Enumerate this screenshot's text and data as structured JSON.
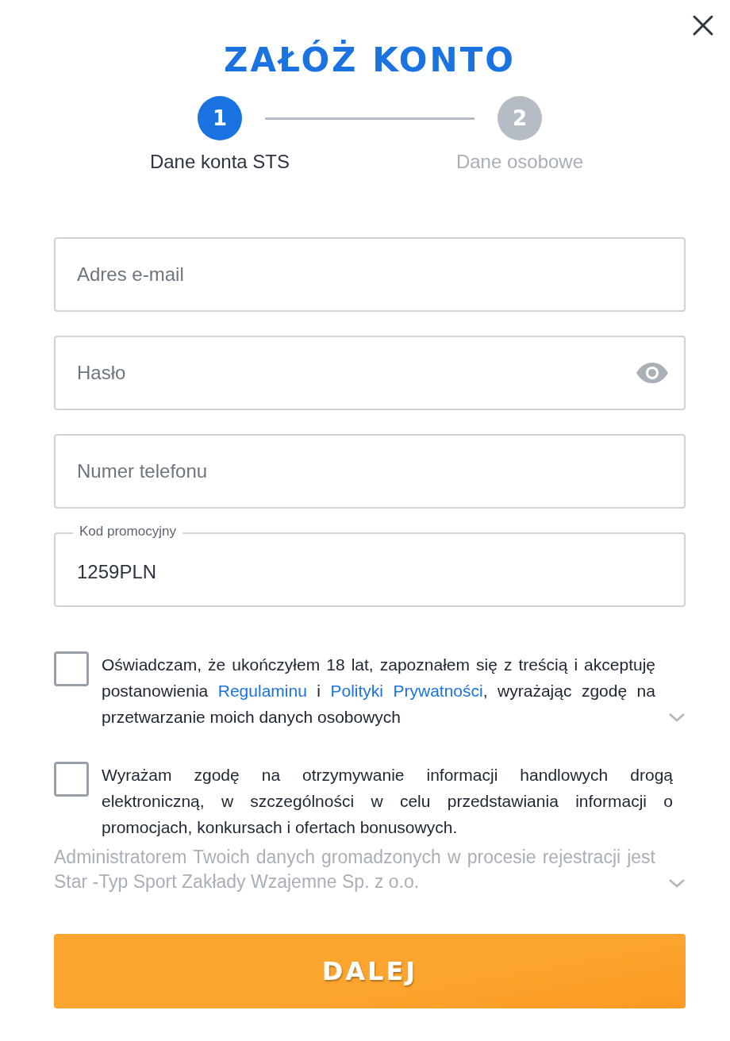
{
  "title": "ZAŁÓŻ KONTO",
  "steps": [
    {
      "number": "1",
      "label": "Dane konta STS",
      "selected": true
    },
    {
      "number": "2",
      "label": "Dane osobowe",
      "selected": false
    }
  ],
  "fields": [
    {
      "placeholder": "Adres e-mail",
      "kind": "text"
    },
    {
      "placeholder": "Hasło",
      "kind": "password"
    },
    {
      "placeholder": "Numer telefonu",
      "kind": "text"
    },
    {
      "label": "Kod promocyjny",
      "value": "1259PLN",
      "kind": "filled"
    }
  ],
  "consents": [
    {
      "checked": false,
      "expandable": true,
      "parts": [
        {
          "kind": "plain",
          "text": "Oświadczam, że ukończyłem 18 lat, zapoznałem się z treścią i akceptuję postanowienia "
        },
        {
          "kind": "link",
          "text": "Regulaminu"
        },
        {
          "kind": "plain",
          "text": " i "
        },
        {
          "kind": "link",
          "text": "Polityki Prywatności"
        },
        {
          "kind": "plain",
          "text": ", wyrażając zgodę na przetwarzanie moich danych osobowych"
        }
      ]
    },
    {
      "checked": false,
      "expandable": false,
      "parts": [
        {
          "kind": "plain",
          "text": "Wyrażam zgodę na otrzymywanie informacji handlowych drogą elektroniczną, w szczególności w celu przedstawiania informacji o promocjach, konkursach i ofertach bonusowych."
        }
      ]
    }
  ],
  "admin_note": {
    "text": "Administratorem Twoich danych gromadzonych w procesie rejestracji jest Star -Typ Sport Zakłady Wzajemne Sp. z o.o.",
    "expandable": true
  },
  "submit_button": "DALEJ"
}
